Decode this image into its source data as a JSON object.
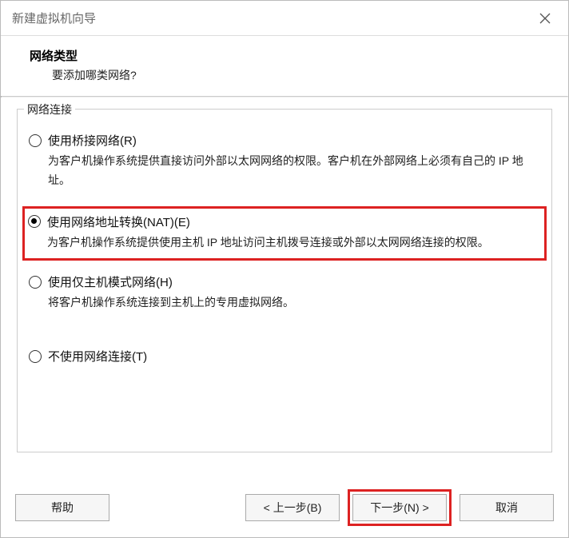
{
  "window": {
    "title": "新建虚拟机向导"
  },
  "header": {
    "heading": "网络类型",
    "subheading": "要添加哪类网络?"
  },
  "group": {
    "legend": "网络连接"
  },
  "options": {
    "bridged": {
      "label": "使用桥接网络(R)",
      "desc": "为客户机操作系统提供直接访问外部以太网网络的权限。客户机在外部网络上必须有自己的 IP 地址。"
    },
    "nat": {
      "label": "使用网络地址转换(NAT)(E)",
      "desc": "为客户机操作系统提供使用主机 IP 地址访问主机拨号连接或外部以太网网络连接的权限。"
    },
    "hostonly": {
      "label": "使用仅主机模式网络(H)",
      "desc": "将客户机操作系统连接到主机上的专用虚拟网络。"
    },
    "none": {
      "label": "不使用网络连接(T)"
    }
  },
  "buttons": {
    "help": "帮助",
    "back": "< 上一步(B)",
    "next": "下一步(N) >",
    "cancel": "取消"
  }
}
